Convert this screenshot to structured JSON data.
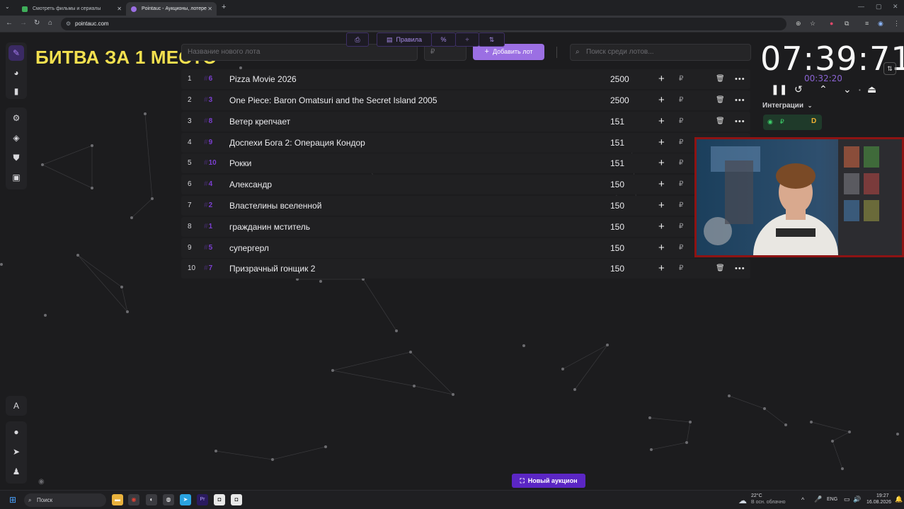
{
  "browser": {
    "tabs": [
      {
        "label": "Смотреть фильмы и сериалы",
        "active": false
      },
      {
        "label": "Pointauc - Аукционы, лотере",
        "active": true
      }
    ],
    "new_tab": "+",
    "url": "pointauc.com"
  },
  "page": {
    "title_overlay": "БИТВА ЗА 1 МЕСТО",
    "lot_input_placeholder": "Название нового лота",
    "amount_placeholder": "₽",
    "add_lot_label": "Добавить лот",
    "search_placeholder": "Поиск среди лотов...",
    "lots": [
      {
        "index": "1",
        "number": "6",
        "name": "Pizza Movie 2026",
        "amount": "2500",
        "has_actions": true
      },
      {
        "index": "2",
        "number": "3",
        "name": "One Piece: Baron Omatsuri and the Secret Island 2005",
        "amount": "2500",
        "has_actions": true
      },
      {
        "index": "3",
        "number": "8",
        "name": "Ветер крепчает",
        "amount": "151",
        "has_actions": true
      },
      {
        "index": "4",
        "number": "9",
        "name": "Доспехи Бога 2: Операция Кондор",
        "amount": "151",
        "has_actions": false
      },
      {
        "index": "5",
        "number": "10",
        "name": "Рокки",
        "amount": "151",
        "has_actions": false
      },
      {
        "index": "6",
        "number": "4",
        "name": "Александр",
        "amount": "150",
        "has_actions": false
      },
      {
        "index": "7",
        "number": "2",
        "name": "Властелины вселенной",
        "amount": "150",
        "has_actions": false
      },
      {
        "index": "8",
        "number": "1",
        "name": "гражданин мститель",
        "amount": "150",
        "has_actions": false
      },
      {
        "index": "9",
        "number": "5",
        "name": "супергерл",
        "amount": "150",
        "has_actions": false
      },
      {
        "index": "10",
        "number": "7",
        "name": "Призрачный гонщик 2",
        "amount": "150",
        "has_actions": true
      }
    ],
    "currency_symbol": "₽",
    "timer": "07:39:71",
    "subtimer": "00:32:20",
    "integrations_label": "Интеграции",
    "bottom": {
      "rules_label": "Правила",
      "new_auction_label": "Новый аукцион"
    }
  },
  "taskbar": {
    "search_label": "Поиск",
    "weather_temp": "22°C",
    "weather_desc": "В осн. облачно",
    "lang": "ENG",
    "time": "19:27",
    "date": "16.08.2026"
  },
  "colors": {
    "accent": "#9b6fe3",
    "accent_dark": "#5b26c4",
    "title_yellow": "#f3e04f",
    "number_purple": "#7b3fd1",
    "webcam_border": "#8e1313"
  },
  "icons": [
    "pen-icon",
    "pie-chart-icon",
    "bar-chart-icon",
    "gear-icon",
    "layers-icon",
    "shield-icon",
    "media-icon",
    "translate-icon",
    "github-icon",
    "telegram-icon",
    "user-icon",
    "eye-icon",
    "plus-icon",
    "ruble-icon",
    "trash-icon",
    "more-icon",
    "pause-icon",
    "reset-icon",
    "chevron-up-icon",
    "chevron-down-icon",
    "eject-icon",
    "swap-icon"
  ]
}
